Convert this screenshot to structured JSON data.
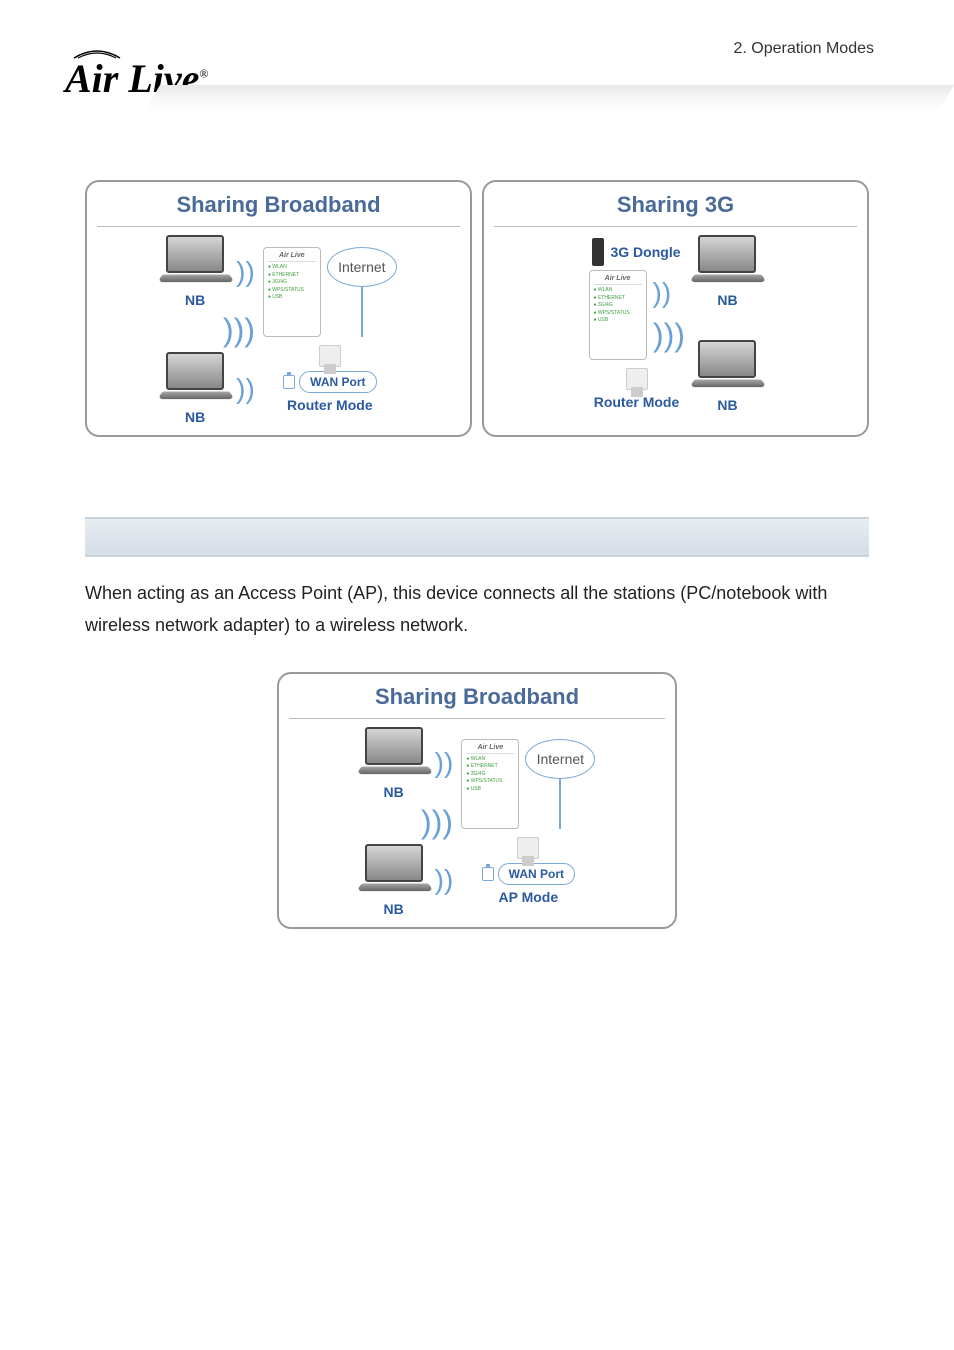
{
  "header": {
    "breadcrumb": "2. Operation Modes",
    "logo": "Air Live"
  },
  "diagrams": {
    "top_left": {
      "title": "Sharing Broadband",
      "nb": "NB",
      "internet": "Internet",
      "wan": "WAN Port",
      "mode": "Router Mode",
      "device_logo": "Air Live"
    },
    "top_right": {
      "title": "Sharing 3G",
      "dongle": "3G Dongle",
      "nb": "NB",
      "mode": "Router Mode",
      "device_logo": "Air Live"
    },
    "center": {
      "title": "Sharing Broadband",
      "nb": "NB",
      "internet": "Internet",
      "wan": "WAN Port",
      "mode": "AP Mode",
      "device_logo": "Air Live"
    }
  },
  "body": {
    "p1": "When acting as an Access Point (AP), this device connects all the stations (PC/notebook with wireless network adapter) to a wireless network."
  }
}
